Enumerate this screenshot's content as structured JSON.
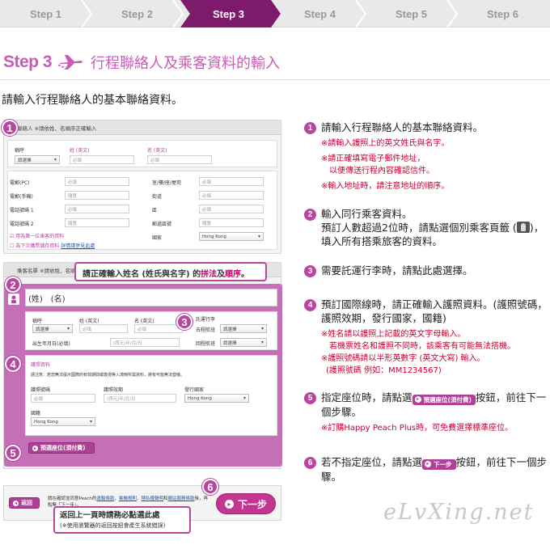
{
  "steps": [
    "Step 1",
    "Step 2",
    "Step 3",
    "Step 4",
    "Step 5",
    "Step 6"
  ],
  "active_step": 3,
  "colors": {
    "accent": "#b845a0",
    "title": "#c95cb5",
    "note_red": "#cc0033"
  },
  "header": {
    "step_label": "Step 3",
    "title": "行程聯絡人及乘客資料的輸入"
  },
  "intro": "請輸入行程聯絡人的基本聯絡資料。",
  "mock": {
    "contact": {
      "head": "聯絡人 ※請依姓、名順序正確輸入",
      "title_label": "稱呼",
      "title_select": "請選擇",
      "surname_label": "姓 (英文)",
      "given_label": "名 (英文)",
      "required": "必填",
      "phone_pc": "電郵(PC)",
      "phone_mobile": "電郵(手機)",
      "tel1": "電話號碼 1",
      "tel2": "電話號碼 2",
      "optional": "隨意",
      "addr_label": "室/樓/座/屋苑",
      "street_label": "街道",
      "district_label": "區",
      "postcode_label": "郵遞區號",
      "country_label": "國家",
      "country_value": "Hong Kong",
      "check1": "用為第一位乘客的資料",
      "check2": "為下次購票儲存資料",
      "privacy_link": "詳情請參見此處"
    },
    "passenger": {
      "head": "乘客名單 ※請依姓、名順序正確輸入",
      "name_placeholder": "(姓)　(名)",
      "title_label": "稱呼",
      "title_select": "請選擇",
      "surname_label": "姓 (英文)",
      "given_label": "名 (英文)",
      "baggage_label": "託運行李",
      "outbound_label": "去程航班",
      "return_label": "回程航班",
      "dob_label": "出生年月日(必填)",
      "dob_placeholder": "(西元)年/月/日",
      "required": "必填",
      "passport_section": "護照資料",
      "passport_note": "請注意：若您無法提示國際的有效期間或簽證等入境時所需資料，將有可能無法登機。",
      "passport_no": "護照號碼",
      "passport_exp": "護照效期",
      "issuing_country": "發行國家",
      "nationality": "國籍",
      "country_value": "Hong Kong",
      "seat_button": "預選座位(須付費)"
    },
    "bottom": {
      "back_button": "返回",
      "consent_text": "請在確認並同意Peach的",
      "consent_link1": "運輸條款",
      "consent_link2": "乘機規則",
      "consent_link3": "隱私權聲明",
      "consent_and": "和",
      "consent_link4": "網站服務條款",
      "consent_end": "後，再點擊「下一步」。",
      "next_button": "下一步"
    },
    "callout_top": {
      "pre": "請正確輸入姓名 (姓氏與名字) 的",
      "red1": "拼法",
      "mid": "及",
      "red2": "順序",
      "end": "。"
    },
    "callout_bottom": {
      "line1": "返回上一頁時請務必點選此處",
      "line2": "(※使用瀏覽器的返回按鈕會產生系統錯誤)"
    },
    "badges": [
      "1",
      "2",
      "3",
      "4",
      "5",
      "6"
    ]
  },
  "instructions": [
    {
      "num": "1",
      "text": "請輸入行程聯絡人的基本聯絡資料。",
      "notes": [
        "※請輸入護照上的英文姓氏與名字。",
        "※請正確填寫電子郵件地址，",
        "以便傳送行程內容確認信件。",
        "※輸入地址時，請注意地址的順序。"
      ]
    },
    {
      "num": "2",
      "text1": "輸入同行乘客資料。",
      "text2": "預訂人數超過2位時，請點選個別乘客頁籤 (",
      "text3": ")，",
      "text4": "填入所有搭乘旅客的資料。"
    },
    {
      "num": "3",
      "text": "需要託運行李時，請點此處選擇。"
    },
    {
      "num": "4",
      "text": "預訂國際線時，請正確輸入護照資料。(護照號碼，護照效期，發行國家，國籍)",
      "notes": [
        "※姓名請以護照上記載的英文字母輸入。",
        "若機票姓名和護照不同時，該乘客有可能無法搭機。",
        "※護照號碼請以半形英數字 (英文大寫) 輸入。",
        "(護照號碼 例如：MM1234567)"
      ]
    },
    {
      "num": "5",
      "pre": "指定座位時，請點選",
      "btn": "預選座位(須付費)",
      "post": "按鈕，前往下一個步驟。",
      "note": "※訂購Happy Peach Plus時，可免費選擇標準座位。"
    },
    {
      "num": "6",
      "pre": "若不指定座位，請點選",
      "btn": "下一步",
      "post": "按鈕，前往下一個步驟。"
    }
  ],
  "watermark": "eLvXing.net"
}
